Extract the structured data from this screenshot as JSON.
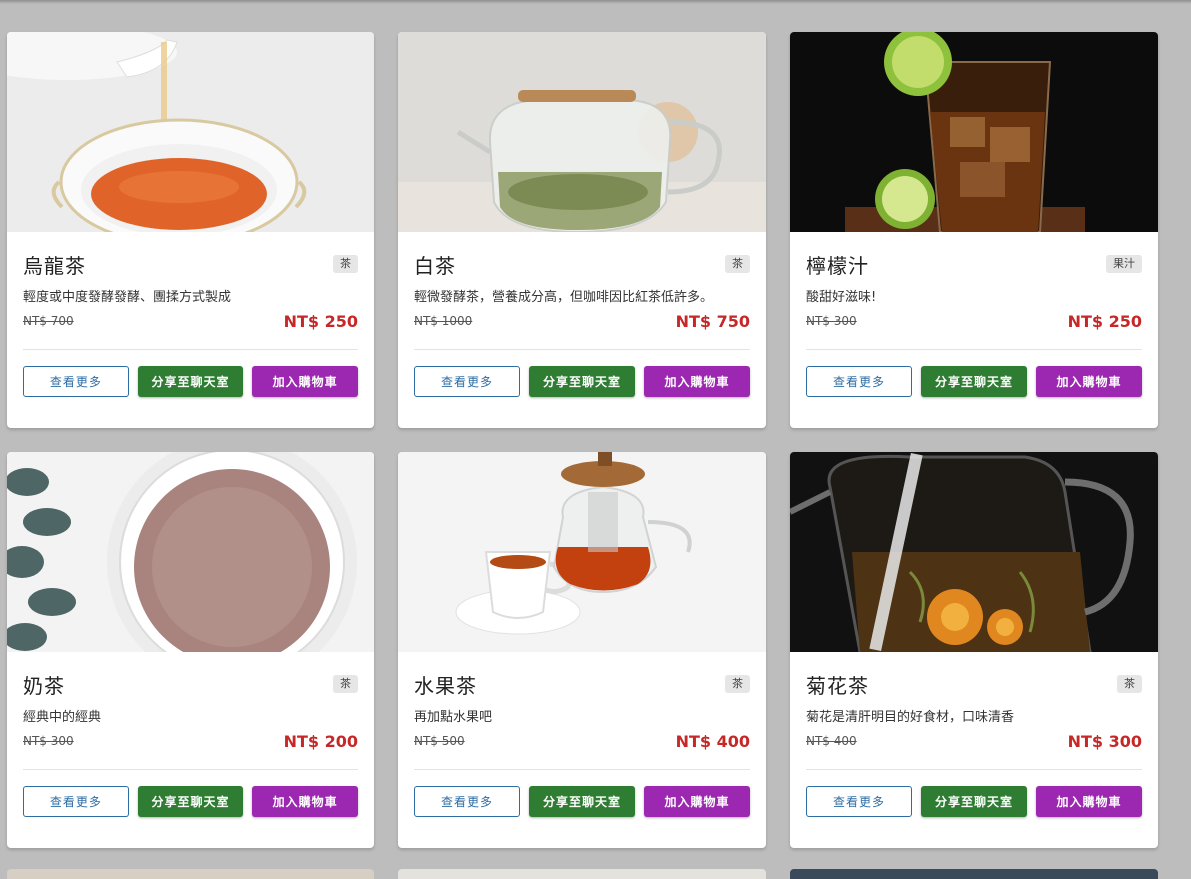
{
  "products": [
    {
      "name": "烏龍茶",
      "category": "茶",
      "description": "輕度或中度發酵發酵、團揉方式製成",
      "original_price": "NT$ 700",
      "sale_price": "NT$ 250",
      "image_icon": "oolong-tea-photo"
    },
    {
      "name": "白茶",
      "category": "茶",
      "description": "輕微發酵茶，營養成分高，但咖啡因比紅茶低許多。",
      "original_price": "NT$ 1000",
      "sale_price": "NT$ 750",
      "image_icon": "white-tea-photo"
    },
    {
      "name": "檸檬汁",
      "category": "果汁",
      "description": "酸甜好滋味!",
      "original_price": "NT$ 300",
      "sale_price": "NT$ 250",
      "image_icon": "lemon-juice-photo"
    },
    {
      "name": "奶茶",
      "category": "茶",
      "description": "經典中的經典",
      "original_price": "NT$ 300",
      "sale_price": "NT$ 200",
      "image_icon": "milk-tea-photo"
    },
    {
      "name": "水果茶",
      "category": "茶",
      "description": "再加點水果吧",
      "original_price": "NT$ 500",
      "sale_price": "NT$ 400",
      "image_icon": "fruit-tea-photo"
    },
    {
      "name": "菊花茶",
      "category": "茶",
      "description": "菊花是清肝明目的好食材，口味清香",
      "original_price": "NT$ 400",
      "sale_price": "NT$ 300",
      "image_icon": "chrysanthemum-tea-photo"
    }
  ],
  "buttons": {
    "view_more": "查看更多",
    "share_to_chat": "分享至聊天室",
    "add_to_cart": "加入購物車"
  },
  "colors": {
    "page_background": "#bdbdbd",
    "sale_price": "#c62828",
    "view_more_border": "#2e6da4",
    "share_button": "#2e7d32",
    "cart_button": "#9c27b0"
  }
}
